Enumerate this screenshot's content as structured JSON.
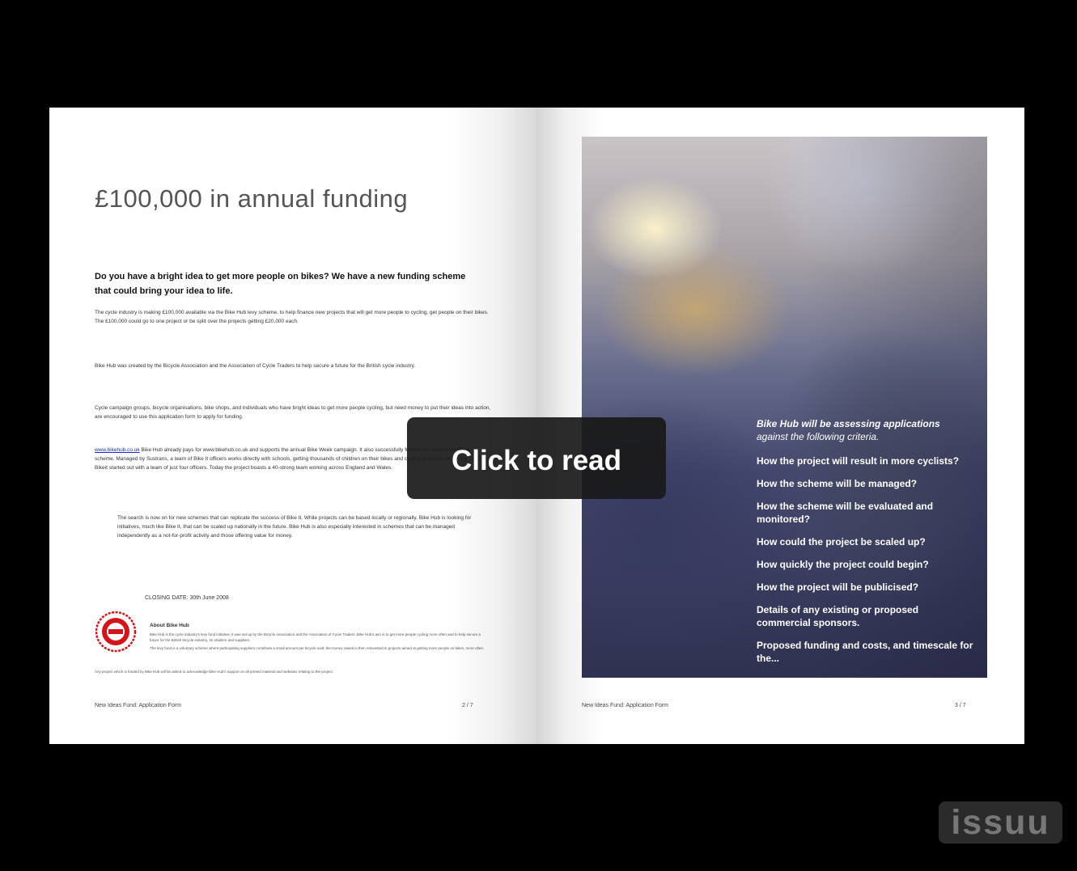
{
  "left_page": {
    "heading": "£100,000 in annual funding",
    "intro": "Do you have a bright idea to get more people on bikes? We have a new funding scheme that could bring your idea to life.",
    "paragraphs": [
      "The cycle industry is making £100,000 available via the Bike Hub levy scheme, to help finance new projects that will get more people to cycling, get people on their bikes. The £100,000 could go to one project or be split over the projects getting £20,000 each.",
      "Bike Hub was created by the Bicycle Association and the Association of Cycle Traders to help secure a future for the British cycle industry.",
      "Cycle campaign groups, bicycle organisations, bike shops, and individuals who have bright ideas to get more people cycling, but need money to put their ideas into action, are encouraged to use this application form to apply for funding.",
      "Bike Hub already pays for www.bikehub.co.uk and supports the annual Bike Week campaign. It also successfully funded the successful Bikeit scheme. Managed by Sustrans, a team of Bike It officers works directly with schools, getting thousands of children on their bikes and cycling to school every day. In 2006, Bikeit started out with a team of just four officers. Today the project boasts a 40-strong team working across England and Wales.",
      "The search is now on for new schemes that can replicate the success of Bike It. While projects can be based locally or regionally, Bike Hub is looking for initiatives, much like Bike It, that can be scaled up nationally in the future. Bike Hub is also especially interested in schemes that can be managed independently as a not-for-profit activity and those offering value for money."
    ],
    "link_text": "www.bikehub.co.uk",
    "closing": "CLOSING DATE: 30th June 2008",
    "about_title": "About Bike Hub",
    "about_text": "Bike Hub is the cycle industry's levy fund initiative; it was set up by the Bicycle Association and the Association of Cycle Traders. Bike Hub's aim is to get more people cycling more often and to help secure a future for the British bicycle industry, its retailers and suppliers.",
    "about_text2": "The levy fund is a voluntary scheme where participating suppliers contribute a small amount per bicycle sold; the money raised is then reinvested in projects aimed at getting more people on bikes, more often.",
    "about_text3": "Any project which is funded by Bike Hub will be asked to acknowledge Bike Hub's support on all printed material and websites relating to the project.",
    "footer_title": "New Ideas Fund: Application Form",
    "page_number": "2 / 7"
  },
  "right_page": {
    "criteria_lead": "Bike Hub will be assessing applications",
    "criteria_lead2": "against the following criteria.",
    "criteria": [
      "How the project will result in more cyclists?",
      "How the scheme will be managed?",
      "How the scheme will be evaluated and monitored?",
      "How could the project be scaled up?",
      "How quickly the project could begin?",
      "How the project will be publicised?",
      "Details of any existing or proposed commercial sponsors.",
      "Proposed funding and costs, and timescale for the..."
    ],
    "footer_title": "New Ideas Fund: Application Form",
    "page_number": "3 / 7"
  },
  "overlay": {
    "label": "Click to read"
  },
  "brand": {
    "logo_text": "issuu"
  },
  "colors": {
    "background": "#000000",
    "overlay": "#191919",
    "link": "#1a2cc0",
    "logo_red": "#d4141b"
  }
}
